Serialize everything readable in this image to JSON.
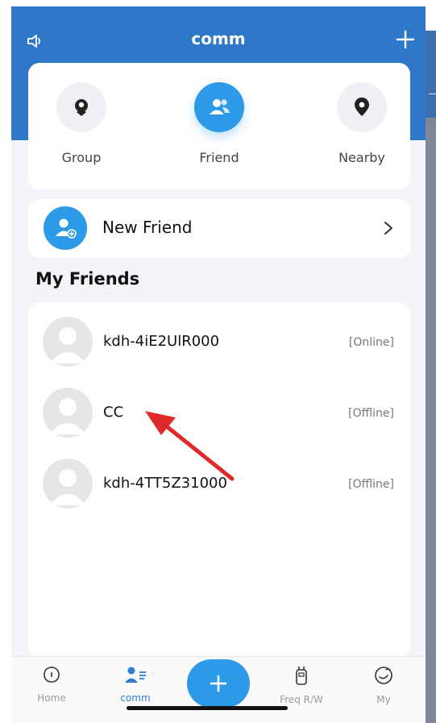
{
  "header": {
    "title": "comm"
  },
  "top_tabs": [
    {
      "label": "Group",
      "icon": "group-pin-icon"
    },
    {
      "label": "Friend",
      "icon": "friends-icon",
      "active": true
    },
    {
      "label": "Nearby",
      "icon": "location-pin-icon"
    }
  ],
  "new_friend": {
    "label": "New Friend"
  },
  "friends_section": {
    "title": "My Friends"
  },
  "friends": [
    {
      "name": "kdh-4iE2UlR000",
      "status": "[Online]"
    },
    {
      "name": "CC",
      "status": "[Offline]"
    },
    {
      "name": "kdh-4TT5Z31000",
      "status": "[Offline]"
    }
  ],
  "bottom_nav": [
    {
      "label": "Home",
      "icon": "home-icon"
    },
    {
      "label": "comm",
      "icon": "comm-icon",
      "active": true
    },
    {
      "label": "Freq R/W",
      "icon": "radio-icon"
    },
    {
      "label": "My",
      "icon": "profile-icon"
    }
  ],
  "colors": {
    "header_blue": "#2f78c9",
    "accent_blue": "#2d9ae8",
    "arrow_red": "#e02a2a"
  }
}
